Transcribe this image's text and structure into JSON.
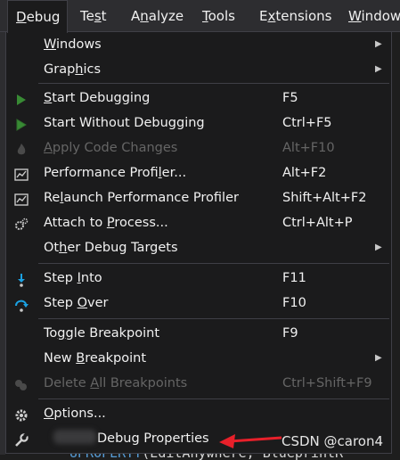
{
  "menubar": {
    "items": [
      {
        "label": "Debug",
        "ul": "D",
        "rest": "ebug"
      },
      {
        "label": "Test",
        "pre": "Te",
        "ul": "s",
        "rest": "t"
      },
      {
        "label": "Analyze",
        "pre": "A",
        "ul": "n",
        "rest": "alyze"
      },
      {
        "label": "Tools",
        "ul": "T",
        "rest": "ools"
      },
      {
        "label": "Extensions",
        "pre": "E",
        "ul": "x",
        "rest": "tensions"
      },
      {
        "label": "Windows",
        "ul": "W",
        "rest": "indow"
      }
    ]
  },
  "menu": {
    "items": [
      {
        "label": "Windows",
        "pre": "",
        "ul": "W",
        "rest": "indows",
        "shortcut": "",
        "submenu": true,
        "disabled": false,
        "icon": ""
      },
      {
        "label": "Graphics",
        "pre": "Grap",
        "ul": "h",
        "rest": "ics",
        "shortcut": "",
        "submenu": true,
        "disabled": false,
        "icon": ""
      },
      {
        "label": "Start Debugging",
        "pre": "",
        "ul": "S",
        "rest": "tart Debugging",
        "shortcut": "F5",
        "submenu": false,
        "disabled": false,
        "icon": "play-icon"
      },
      {
        "label": "Start Without Debugging",
        "pre": "Start Without Debugging",
        "ul": "",
        "rest": "",
        "shortcut": "Ctrl+F5",
        "submenu": false,
        "disabled": false,
        "icon": "play-outline-icon"
      },
      {
        "label": "Apply Code Changes",
        "pre": "",
        "ul": "A",
        "rest": "pply Code Changes",
        "shortcut": "Alt+F10",
        "submenu": false,
        "disabled": true,
        "icon": "flame-icon"
      },
      {
        "label": "Performance Profiler...",
        "pre": "Performance Profi",
        "ul": "l",
        "rest": "er...",
        "shortcut": "Alt+F2",
        "submenu": false,
        "disabled": false,
        "icon": "profiler-icon"
      },
      {
        "label": "Relaunch Performance Profiler",
        "pre": "Re",
        "ul": "l",
        "rest": "aunch Performance Profiler",
        "shortcut": "Shift+Alt+F2",
        "submenu": false,
        "disabled": false,
        "icon": "profiler-icon"
      },
      {
        "label": "Attach to Process...",
        "pre": "Attach to ",
        "ul": "P",
        "rest": "rocess...",
        "shortcut": "Ctrl+Alt+P",
        "submenu": false,
        "disabled": false,
        "icon": "gears-icon"
      },
      {
        "label": "Other Debug Targets",
        "pre": "Ot",
        "ul": "h",
        "rest": "er Debug Targets",
        "shortcut": "",
        "submenu": true,
        "disabled": false,
        "icon": ""
      },
      {
        "label": "Step Into",
        "pre": "Step ",
        "ul": "I",
        "rest": "nto",
        "shortcut": "F11",
        "submenu": false,
        "disabled": false,
        "icon": "step-into-icon"
      },
      {
        "label": "Step Over",
        "pre": "Step ",
        "ul": "O",
        "rest": "ver",
        "shortcut": "F10",
        "submenu": false,
        "disabled": false,
        "icon": "step-over-icon"
      },
      {
        "label": "Toggle Breakpoint",
        "pre": "To",
        "ul": "g",
        "rest": "gle Breakpoint",
        "shortcut": "F9",
        "submenu": false,
        "disabled": false,
        "icon": ""
      },
      {
        "label": "New Breakpoint",
        "pre": "New ",
        "ul": "B",
        "rest": "reakpoint",
        "shortcut": "",
        "submenu": true,
        "disabled": false,
        "icon": ""
      },
      {
        "label": "Delete All Breakpoints",
        "pre": "Delete ",
        "ul": "A",
        "rest": "ll Breakpoints",
        "shortcut": "Ctrl+Shift+F9",
        "submenu": false,
        "disabled": true,
        "icon": "delete-breakpoints-icon"
      },
      {
        "label": "Options...",
        "pre": "",
        "ul": "O",
        "rest": "ptions...",
        "shortcut": "",
        "submenu": false,
        "disabled": false,
        "icon": "gear-icon"
      },
      {
        "label": "Debug Properties",
        "pre": "",
        "ul": "",
        "rest": "Debug Properties",
        "shortcut": "",
        "submenu": false,
        "disabled": false,
        "icon": "wrench-icon"
      }
    ]
  },
  "editor": {
    "code_keyword": "UPROPERTY",
    "code_rest": "(EditAnywhere, BlueprintR"
  },
  "watermark": "CSDN @caron4",
  "colors": {
    "accent": "#1e1e1e",
    "menu_bg": "#1b1b1c",
    "play_green": "#388a34",
    "step_blue": "#1ba1e2",
    "annotation_red": "#e8202a"
  }
}
